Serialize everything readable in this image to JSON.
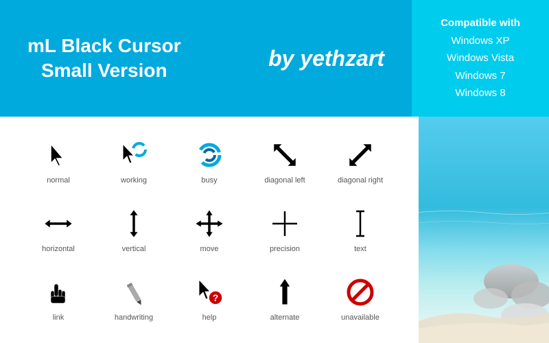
{
  "header": {
    "title_line1": "mL Black Cursor",
    "title_line2": "Small Version",
    "by_label": "by yethzart",
    "compatible_title": "Compatible with",
    "compatible_os": [
      "Windows XP",
      "Windows Vista",
      "Windows 7",
      "Windows 8"
    ]
  },
  "cursors": {
    "rows": [
      [
        {
          "id": "normal",
          "label": "normal"
        },
        {
          "id": "working",
          "label": "working"
        },
        {
          "id": "busy",
          "label": "busy"
        },
        {
          "id": "diagonal-left",
          "label": "diagonal left"
        },
        {
          "id": "diagonal-right",
          "label": "diagonal right"
        }
      ],
      [
        {
          "id": "horizontal",
          "label": "horizontal"
        },
        {
          "id": "vertical",
          "label": "vertical"
        },
        {
          "id": "move",
          "label": "move"
        },
        {
          "id": "precision",
          "label": "precision"
        },
        {
          "id": "text",
          "label": "text"
        }
      ],
      [
        {
          "id": "link",
          "label": "link"
        },
        {
          "id": "handwriting",
          "label": "handwriting"
        },
        {
          "id": "help",
          "label": "help"
        },
        {
          "id": "alternate",
          "label": "alternate"
        },
        {
          "id": "unavailable",
          "label": "unavailable"
        }
      ]
    ]
  }
}
